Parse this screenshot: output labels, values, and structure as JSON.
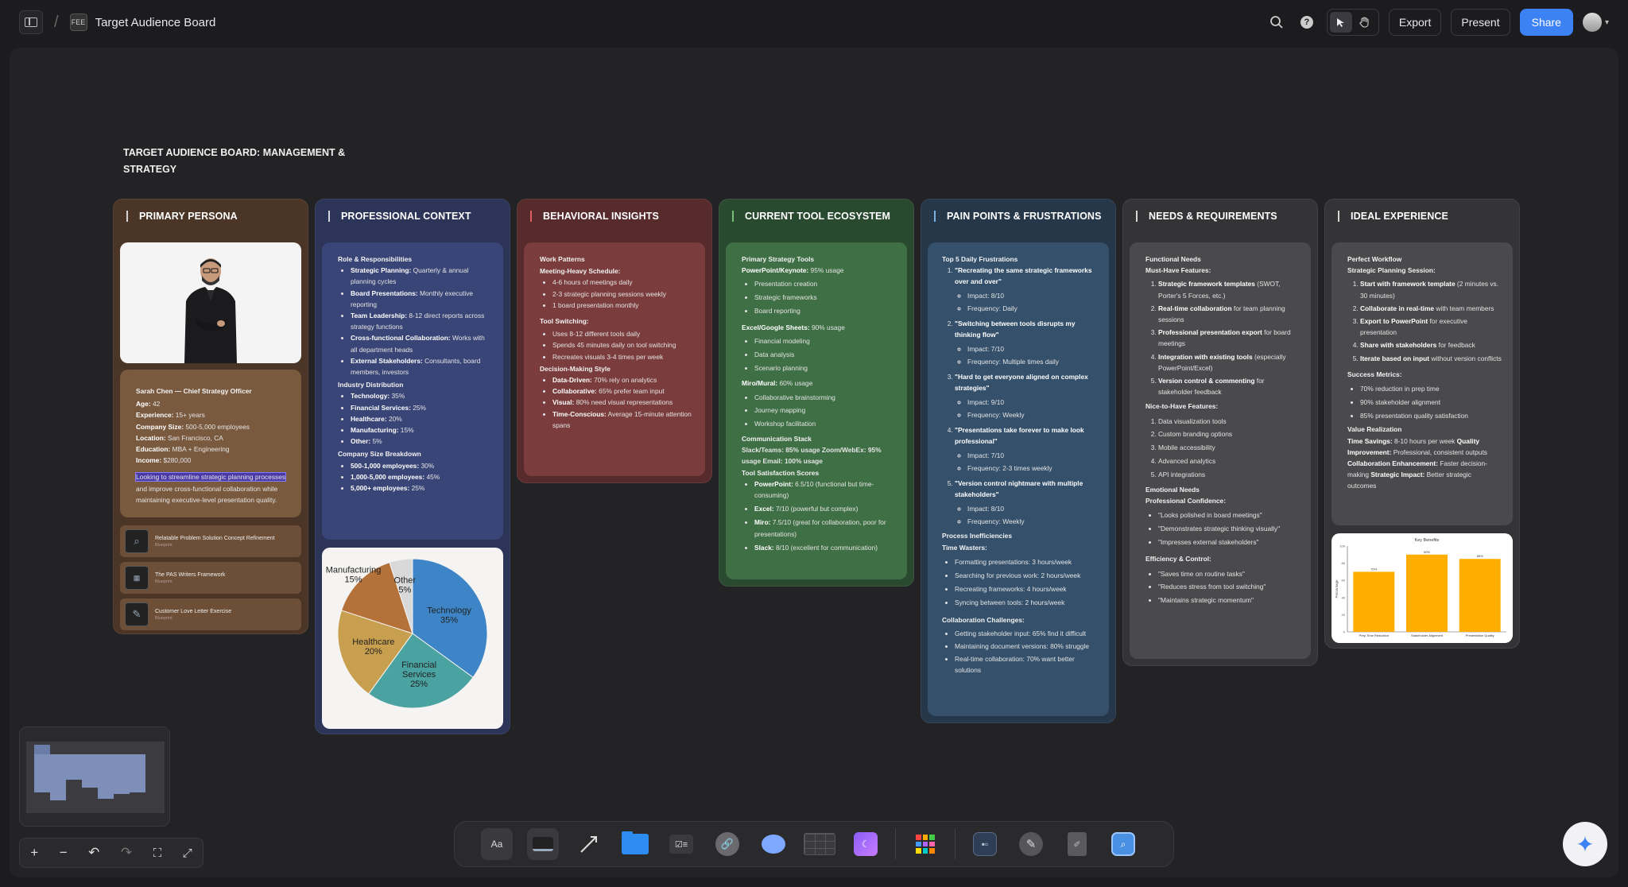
{
  "topbar": {
    "board_icon_label": "FEE",
    "title": "Target Audience Board",
    "export_label": "Export",
    "present_label": "Present",
    "share_label": "Share"
  },
  "board": {
    "heading": "TARGET AUDIENCE BOARD: MANAGEMENT & STRATEGY"
  },
  "columns": {
    "persona": {
      "title": "PRIMARY PERSONA",
      "name_line": "Sarah Chen — Chief Strategy Officer",
      "fields": [
        {
          "k": "Age:",
          "v": " 42"
        },
        {
          "k": "Experience:",
          "v": " 15+ years"
        },
        {
          "k": "Company Size:",
          "v": " 500-5,000 employees"
        },
        {
          "k": "Location:",
          "v": " San Francisco, CA"
        },
        {
          "k": "Education:",
          "v": " MBA + Engineering"
        },
        {
          "k": "Income:",
          "v": " $280,000"
        }
      ],
      "quote_highlight": "Looking to streamline strategic planning processes",
      "quote_rest": "and improve cross-functional collaboration while maintaining executive-level presentation quality.",
      "related": [
        {
          "title": "Relatable Problem Solution Concept Refinement",
          "sub": "Blueprint"
        },
        {
          "title": "The PAS Writers Framework",
          "sub": "Blueprint"
        },
        {
          "title": "Customer Love Letter Exercise",
          "sub": "Blueprint"
        }
      ]
    },
    "context": {
      "title": "PROFESSIONAL CONTEXT",
      "roles_h": "Role & Responsibilities",
      "roles": [
        {
          "k": "Strategic Planning:",
          "v": " Quarterly & annual planning cycles"
        },
        {
          "k": "Board Presentations:",
          "v": " Monthly executive reporting"
        },
        {
          "k": "Team Leadership:",
          "v": " 8-12 direct reports across strategy functions"
        },
        {
          "k": "Cross-functional Collaboration:",
          "v": " Works with all department heads"
        },
        {
          "k": "External Stakeholders:",
          "v": " Consultants, board members, investors"
        }
      ],
      "industry_h": "Industry Distribution",
      "industry": [
        {
          "k": "Technology:",
          "v": " 35%"
        },
        {
          "k": "Financial Services:",
          "v": " 25%"
        },
        {
          "k": "Healthcare:",
          "v": " 20%"
        },
        {
          "k": "Manufacturing:",
          "v": " 15%"
        },
        {
          "k": "Other:",
          "v": " 5%"
        }
      ],
      "size_h": "Company Size Breakdown",
      "sizes": [
        {
          "k": "500-1,000 employees:",
          "v": " 30%"
        },
        {
          "k": "1,000-5,000 employees:",
          "v": " 45%"
        },
        {
          "k": "5,000+ employees:",
          "v": " 25%"
        }
      ]
    },
    "behavior": {
      "title": "BEHAVIORAL INSIGHTS",
      "work_h": "Work Patterns",
      "meeting_h": "Meeting-Heavy Schedule:",
      "meetings": [
        "4-6 hours of meetings daily",
        "2-3 strategic planning sessions weekly",
        "1 board presentation monthly"
      ],
      "switch_h": "Tool Switching:",
      "switching": [
        "Uses 8-12 different tools daily",
        "Spends 45 minutes daily on tool switching",
        "Recreates visuals 3-4 times per week"
      ],
      "decision_h": "Decision-Making Style",
      "decisions": [
        {
          "k": "Data-Driven:",
          "v": " 70% rely on analytics"
        },
        {
          "k": "Collaborative:",
          "v": " 65% prefer team input"
        },
        {
          "k": "Visual:",
          "v": " 80% need visual representations"
        },
        {
          "k": "Time-Conscious:",
          "v": " Average 15-minute attention spans"
        }
      ]
    },
    "tools": {
      "title": "CURRENT TOOL ECOSYSTEM",
      "primary_h": "Primary Strategy Tools",
      "ppt_k": "PowerPoint/Keynote:",
      "ppt_v": " 95% usage",
      "ppt": [
        "Presentation creation",
        "Strategic frameworks",
        "Board reporting"
      ],
      "excel_k": "Excel/Google Sheets:",
      "excel_v": " 90% usage",
      "excel": [
        "Financial modeling",
        "Data analysis",
        "Scenario planning"
      ],
      "miro_k": "Miro/Mural:",
      "miro_v": " 60% usage",
      "miro": [
        "Collaborative brainstorming",
        "Journey mapping",
        "Workshop facilitation"
      ],
      "comm_h": "Communication Stack",
      "comm_line": "Slack/Teams: 85% usage Zoom/WebEx: 95% usage Email: 100% usage",
      "sat_h": "Tool Satisfaction Scores",
      "sat": [
        {
          "k": "PowerPoint:",
          "v": " 6.5/10 (functional but time-consuming)"
        },
        {
          "k": "Excel:",
          "v": " 7/10 (powerful but complex)"
        },
        {
          "k": "Miro:",
          "v": " 7.5/10 (great for collaboration, poor for presentations)"
        },
        {
          "k": "Slack:",
          "v": " 8/10 (excellent for communication)"
        }
      ]
    },
    "pain": {
      "title": "PAIN POINTS & FRUSTRATIONS",
      "top_h": "Top 5 Daily Frustrations",
      "frustrations": [
        {
          "t": "\"Recreating the same strategic frameworks over and over\"",
          "impact": "Impact: 8/10",
          "freq": "Frequency: Daily"
        },
        {
          "t": "\"Switching between tools disrupts my thinking flow\"",
          "impact": "Impact: 7/10",
          "freq": "Frequency: Multiple times daily"
        },
        {
          "t": "\"Hard to get everyone aligned on complex strategies\"",
          "impact": "Impact: 9/10",
          "freq": "Frequency: Weekly"
        },
        {
          "t": "\"Presentations take forever to make look professional\"",
          "impact": "Impact: 7/10",
          "freq": "Frequency: 2-3 times weekly"
        },
        {
          "t": "\"Version control nightmare with multiple stakeholders\"",
          "impact": "Impact: 8/10",
          "freq": "Frequency: Weekly"
        }
      ],
      "process_h": "Process Inefficiencies",
      "waste_h": "Time Wasters:",
      "wasters": [
        "Formatting presentations: 3 hours/week",
        "Searching for previous work: 2 hours/week",
        "Recreating frameworks: 4 hours/week",
        "Syncing between tools: 2 hours/week"
      ],
      "collab_h": "Collaboration Challenges:",
      "collab": [
        "Getting stakeholder input: 65% find it difficult",
        "Maintaining document versions: 80% struggle",
        "Real-time collaboration: 70% want better solutions"
      ]
    },
    "needs": {
      "title": "NEEDS & REQUIREMENTS",
      "func_h": "Functional Needs",
      "must_h": "Must-Have Features:",
      "must": [
        {
          "k": "Strategic framework templates",
          "v": " (SWOT, Porter's 5 Forces, etc.)"
        },
        {
          "k": "Real-time collaboration",
          "v": " for team planning sessions"
        },
        {
          "k": "Professional presentation export",
          "v": " for board meetings"
        },
        {
          "k": "Integration with existing tools",
          "v": " (especially PowerPoint/Excel)"
        },
        {
          "k": "Version control & commenting",
          "v": " for stakeholder feedback"
        }
      ],
      "nice_h": "Nice-to-Have Features:",
      "nice": [
        "Data visualization tools",
        "Custom branding options",
        "Mobile accessibility",
        "Advanced analytics",
        "API integrations"
      ],
      "emo_h": "Emotional Needs",
      "conf_h": "Professional Confidence:",
      "conf": [
        "\"Looks polished in board meetings\"",
        "\"Demonstrates strategic thinking visually\"",
        "\"Impresses external stakeholders\""
      ],
      "eff_h": "Efficiency & Control:",
      "eff": [
        "\"Saves time on routine tasks\"",
        "\"Reduces stress from tool switching\"",
        "\"Maintains strategic momentum\""
      ]
    },
    "ideal": {
      "title": "IDEAL EXPERIENCE",
      "flow_h": "Perfect Workflow",
      "session_h": "Strategic Planning Session:",
      "steps": [
        {
          "k": "Start with framework template",
          "v": " (2 minutes vs. 30 minutes)"
        },
        {
          "k": "Collaborate in real-time",
          "v": " with team members"
        },
        {
          "k": "Export to PowerPoint",
          "v": " for executive presentation"
        },
        {
          "k": "Share with stakeholders",
          "v": " for feedback"
        },
        {
          "k": "Iterate based on input",
          "v": " without version conflicts"
        }
      ],
      "metrics_h": "Success Metrics:",
      "metrics": [
        "70% reduction in prep time",
        "90% stakeholder alignment",
        "85% presentation quality satisfaction"
      ],
      "value_h": "Value Realization",
      "value_1k": "Time Savings:",
      "value_1v": " 8-10 hours per week ",
      "value_2k": "Quality Improvement:",
      "value_2v": " Professional, consistent outputs ",
      "value_3k": "Collaboration Enhancement:",
      "value_3v": " Faster decision-making ",
      "value_4k": "Strategic Impact:",
      "value_4v": " Better strategic outcomes"
    }
  },
  "chart_data": [
    {
      "type": "pie",
      "labels": [
        "Technology",
        "Financial Services",
        "Healthcare",
        "Manufacturing",
        "Other"
      ],
      "values": [
        35,
        25,
        20,
        15,
        5
      ],
      "display": [
        "Technology\n35%",
        "Financial\nServices\n25%",
        "Healthcare\n20%",
        "Manufacturing\n15%",
        "Other\n5%"
      ],
      "colors": [
        "#3d85c6",
        "#4aa3a0",
        "#c89f4e",
        "#b4713a",
        "#d9d9d9"
      ]
    },
    {
      "type": "bar",
      "title": "Key Benefits",
      "categories": [
        "Prep Time Reduction",
        "Stakeholder Alignment",
        "Presentation Quality"
      ],
      "values": [
        70,
        90,
        85
      ],
      "labels": [
        "70%",
        "90%",
        "85%"
      ],
      "ylabel": "Percentage",
      "ylim": [
        0,
        100
      ],
      "yticks": [
        0,
        20,
        40,
        60,
        80,
        100
      ],
      "color": "#ffae00"
    }
  ]
}
